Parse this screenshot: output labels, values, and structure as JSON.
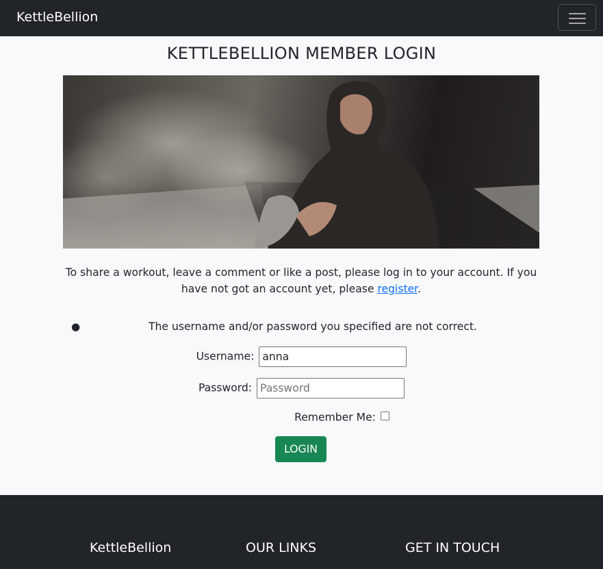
{
  "navbar": {
    "brand": "KettleBellion",
    "toggler_icon": "hamburger-icon"
  },
  "page": {
    "title": "KETTLEBELLION MEMBER LOGIN"
  },
  "intro": {
    "text_before": "To share a workout, leave a comment or like a post, please log in to your account. If you have not got an account yet, please ",
    "register_link": "register",
    "text_after": "."
  },
  "errors": [
    "The username and/or password you specified are not correct."
  ],
  "form": {
    "username_label": "Username:",
    "username_value": "anna",
    "password_label": "Password:",
    "password_placeholder": "Password",
    "remember_label": "Remember Me:",
    "remember_checked": false,
    "login_label": "LOGIN"
  },
  "footer": {
    "col1_title": "KettleBellion",
    "col2_title": "OUR LINKS",
    "col3_title": "GET IN TOUCH"
  },
  "colors": {
    "nav_bg": "#212529",
    "page_bg": "#f8f9fa",
    "link": "#0d6efd",
    "button": "#198754"
  }
}
